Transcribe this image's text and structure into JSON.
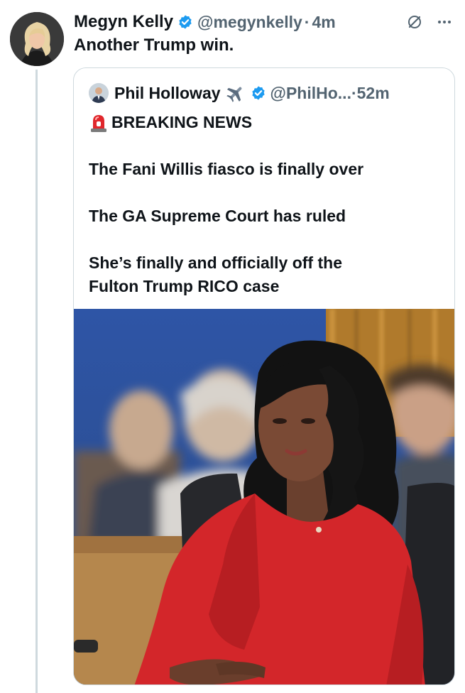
{
  "tweet": {
    "author_name": "Megyn Kelly",
    "handle": "@megynkelly",
    "separator": "·",
    "time": "4m",
    "text": "Another Trump win."
  },
  "quote": {
    "author_name": "Phil Holloway",
    "handle": "@PhilHo...",
    "separator": "·",
    "time": "52m",
    "lines": [
      "BREAKING NEWS",
      "The Fani Willis fiasco is finally over",
      "The GA Supreme Court has ruled",
      "She’s finally and officially off the",
      "Fulton Trump RICO case"
    ]
  },
  "icons": {
    "verified": "verified-badge-icon",
    "grok": "grok-icon",
    "more": "more-icon",
    "plane": "airplane-emoji",
    "siren": "siren-emoji"
  },
  "colors": {
    "verified_blue": "#1d9bf0",
    "secondary_text": "#536471",
    "border": "#cfd9de",
    "dress_red": "#d3262a"
  }
}
